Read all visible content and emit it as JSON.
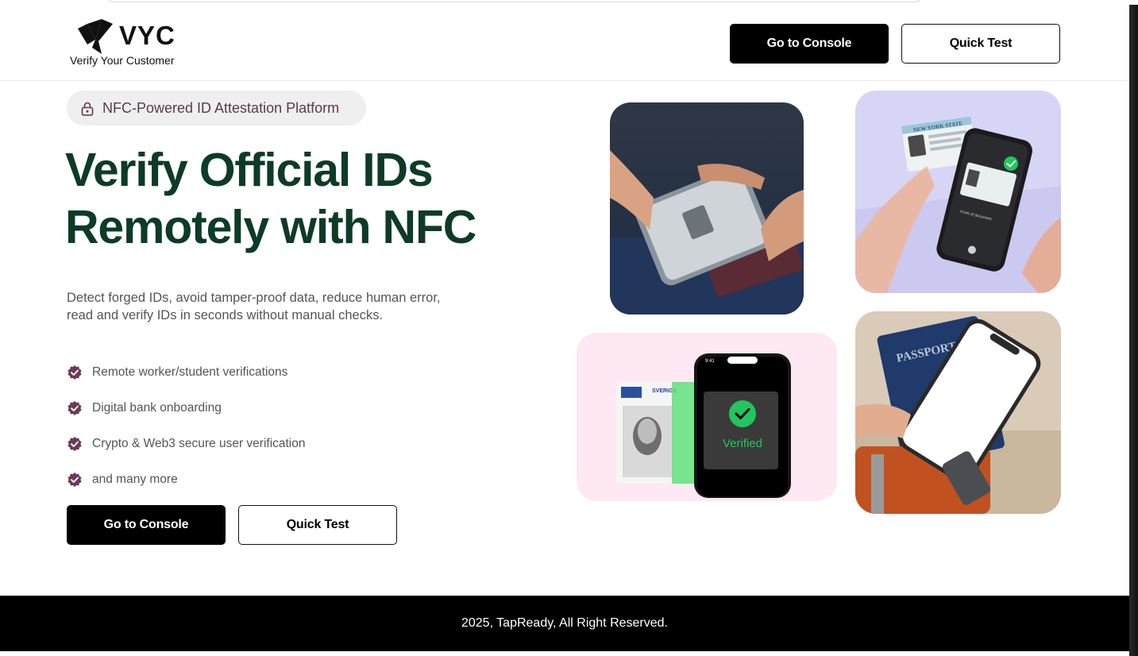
{
  "brand": {
    "name": "VYC",
    "tagline": "Verify Your Customer"
  },
  "header": {
    "console_label": "Go to Console",
    "quick_test_label": "Quick Test"
  },
  "hero": {
    "badge_icon": "lock-icon",
    "badge_text": "NFC-Powered ID Attestation Platform",
    "headline_line1": "Verify Official IDs",
    "headline_line2": "Remotely with NFC",
    "description_line1": "Detect forged IDs, avoid tamper-proof data, reduce human error,",
    "description_line2": "read and verify IDs in seconds without manual checks.",
    "features": [
      "Remote worker/student verifications",
      "Digital bank onboarding",
      "Crypto & Web3 secure user verification",
      "and many more"
    ],
    "console_label": "Go to Console",
    "quick_test_label": "Quick Test"
  },
  "images": {
    "verified_label": "Verified",
    "passport_label": "PASSPORT",
    "phone_time": "9:41",
    "card_state": "NEW YORK STATE",
    "card_caption": "Front of document",
    "card_country": "SVERIGE"
  },
  "colors": {
    "headline": "#0d3b27",
    "badge_text": "#5a3a4e",
    "check_badge": "#6b3a57",
    "verified_green": "#22c55e"
  },
  "footer": {
    "copyright": "2025, TapReady, All Right Reserved."
  }
}
